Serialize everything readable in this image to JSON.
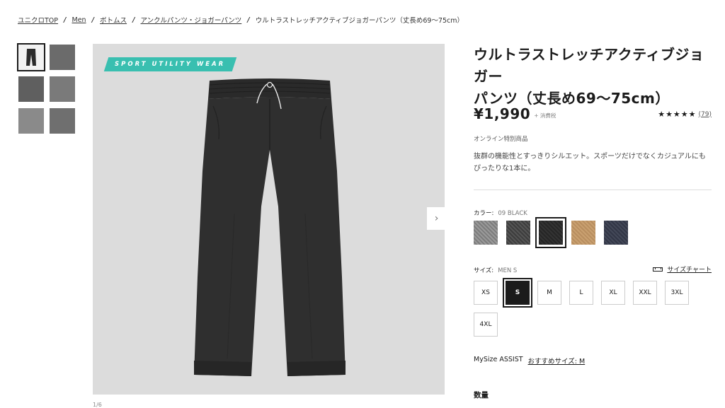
{
  "breadcrumb": {
    "items": [
      "ユニクロTOP",
      "Men",
      "ボトムス",
      "アンクルパンツ・ジョガーパンツ"
    ],
    "current": "ウルトラストレッチアクティブジョガーパンツ（丈長め69〜75cm）",
    "separator": "/"
  },
  "gallery": {
    "banner_text": "SPORT UTILITY WEAR",
    "counter": "1/6",
    "next_icon": "›",
    "thumb_colors": [
      "#2b2b2b",
      "#6b6b6b",
      "#5f5f5f",
      "#7a7a7a",
      "#8a8a8a",
      "#6f6f6f"
    ]
  },
  "product": {
    "title_line1": "ウルトラストレッチアクティブジョガー",
    "title_line2": "パンツ（丈長め69〜75cm）",
    "price": "¥1,990",
    "tax_note": "+ 消費税",
    "rating_stars": "★★★★★",
    "rating_value": 4.5,
    "review_count": "(79)",
    "online_only": "オンライン特別商品",
    "description": "抜群の機能性とすっきりシルエット。スポーツだけでなくカジュアルにもぴったりな1本に。"
  },
  "color": {
    "label": "カラー:",
    "selected_value": "09 BLACK",
    "swatches": [
      {
        "name": "swatch-gray",
        "color": "#8c8c8c"
      },
      {
        "name": "swatch-dark-gray",
        "color": "#4a4a4a"
      },
      {
        "name": "swatch-black",
        "color": "#2b2b2b"
      },
      {
        "name": "swatch-beige",
        "color": "#c49a6c"
      },
      {
        "name": "swatch-navy",
        "color": "#3a3f4e"
      }
    ],
    "selected_index": 2
  },
  "size": {
    "label": "サイズ:",
    "selected_value": "MEN S",
    "chart_link": "サイズチャート",
    "options": [
      "XS",
      "S",
      "M",
      "L",
      "XL",
      "XXL",
      "3XL",
      "4XL"
    ],
    "selected_index": 1
  },
  "mysize": {
    "label": "MySize ASSIST",
    "recommend": "おすすめサイズ: M"
  },
  "quantity": {
    "label": "数量"
  },
  "colors": {
    "accent_teal": "#39bfb0",
    "text": "#1b1b1b"
  }
}
